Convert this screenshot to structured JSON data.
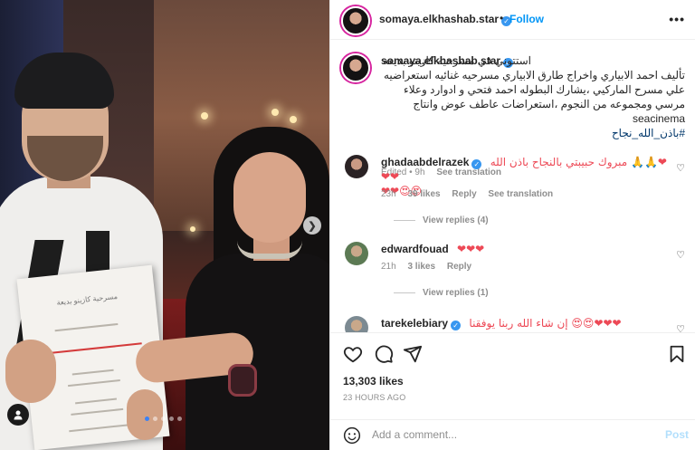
{
  "post": {
    "username": "somaya.elkhashab.star",
    "follow_label": "Follow",
    "bullet": "•",
    "more": "•••",
    "verified_mark": "✓"
  },
  "caption": {
    "username": "somaya.elkhashab.star",
    "text": "استتوني في مسرحيه كازينو بديعه تأليف احمد الابياري واخراج طارق الابياري مسرحيه غنائيه استعراضيه علي مسرح الماركيي ،يشارك البطوله احمد فتحي و ادوارد وعلاء مرسي ومجموعه من النجوم ،استعراضات عاطف عوض وانتاج seacinema",
    "hashtag": "#باذن_الله_نجاح",
    "edited": "Edited • 9h",
    "see_translation": "See translation"
  },
  "comments": [
    {
      "username": "ghadaabdelrazek",
      "text": "مبروك حبيبتي بالنجاح باذن الله 🙏🙏❤❤❤",
      "text_line2": "❤❤😍😍",
      "time": "23h",
      "likes": "39 likes",
      "reply": "Reply",
      "see_translation": "See translation",
      "view_replies": "View replies (4)"
    },
    {
      "username": "edwardfouad",
      "text": "❤❤❤",
      "time": "21h",
      "likes": "3 likes",
      "reply": "Reply",
      "view_replies": "View replies (1)"
    },
    {
      "username": "tarekelebiary",
      "text": "إن شاء الله ربنا يوفقنا 😍😍❤❤❤"
    }
  ],
  "actions": {
    "likes": "13,303 likes",
    "time_ago": "23 HOURS AGO"
  },
  "add_comment": {
    "placeholder": "Add a comment...",
    "post_label": "Post"
  },
  "media": {
    "paper_title": "مسرحية كازينو بديعة",
    "carousel_dots": 5,
    "active_dot": 0
  },
  "colors": {
    "accent": "#0095f6",
    "heart": "#ed4956",
    "muted": "#8e8e8e",
    "verified": "#3897f0"
  }
}
